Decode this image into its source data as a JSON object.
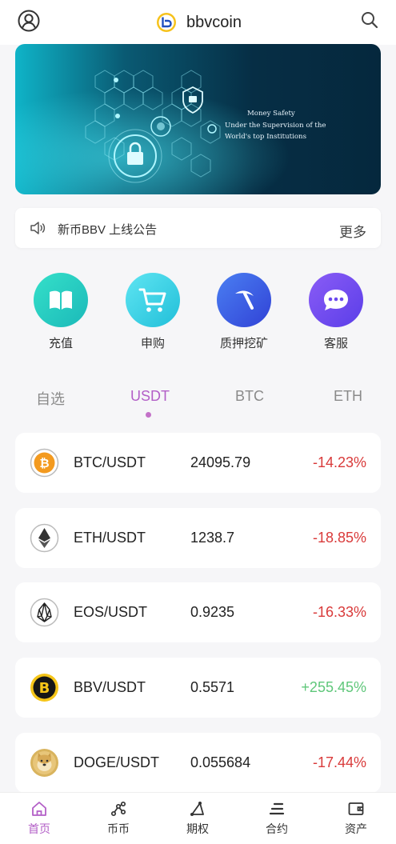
{
  "header": {
    "title": "bbvcoin",
    "user_icon": "user-circle-icon",
    "search_icon": "search-icon",
    "logo_icon": "bbvcoin-logo-icon"
  },
  "banner": {
    "lines": [
      "Money Safety",
      "Under the Supervision of the",
      "World's top Institutions"
    ]
  },
  "notice": {
    "text": "新币BBV 上线公告",
    "more": "更多",
    "icon": "speaker-icon"
  },
  "quick_actions": [
    {
      "label": "充值",
      "icon": "book-icon",
      "color": "#2fd3c0"
    },
    {
      "label": "申购",
      "icon": "cart-icon",
      "color": "#38d0e4"
    },
    {
      "label": "质押挖矿",
      "icon": "pickaxe-icon",
      "color": "#3a63e8"
    },
    {
      "label": "客服",
      "icon": "chat-icon",
      "color": "#6b4df0"
    }
  ],
  "tabs": [
    "自选",
    "USDT",
    "BTC",
    "ETH"
  ],
  "active_tab": "USDT",
  "markets": [
    {
      "pair": "BTC/USDT",
      "price": "24095.79",
      "change": "-14.23%",
      "trend": "down",
      "icon": "btc-icon"
    },
    {
      "pair": "ETH/USDT",
      "price": "1238.7",
      "change": "-18.85%",
      "trend": "down",
      "icon": "eth-icon"
    },
    {
      "pair": "EOS/USDT",
      "price": "0.9235",
      "change": "-16.33%",
      "trend": "down",
      "icon": "eos-icon"
    },
    {
      "pair": "BBV/USDT",
      "price": "0.5571",
      "change": "+255.45%",
      "trend": "up",
      "icon": "bbv-icon"
    },
    {
      "pair": "DOGE/USDT",
      "price": "0.055684",
      "change": "-17.44%",
      "trend": "down",
      "icon": "doge-icon"
    }
  ],
  "colors": {
    "accent": "#b35fc7",
    "down": "#d93a3a",
    "up": "#5fc77a"
  },
  "tabbar": [
    {
      "label": "首页",
      "icon": "home-icon"
    },
    {
      "label": "币币",
      "icon": "exchange-icon"
    },
    {
      "label": "期权",
      "icon": "options-icon"
    },
    {
      "label": "合约",
      "icon": "contract-icon"
    },
    {
      "label": "资产",
      "icon": "wallet-icon"
    }
  ],
  "active_nav": "首页"
}
